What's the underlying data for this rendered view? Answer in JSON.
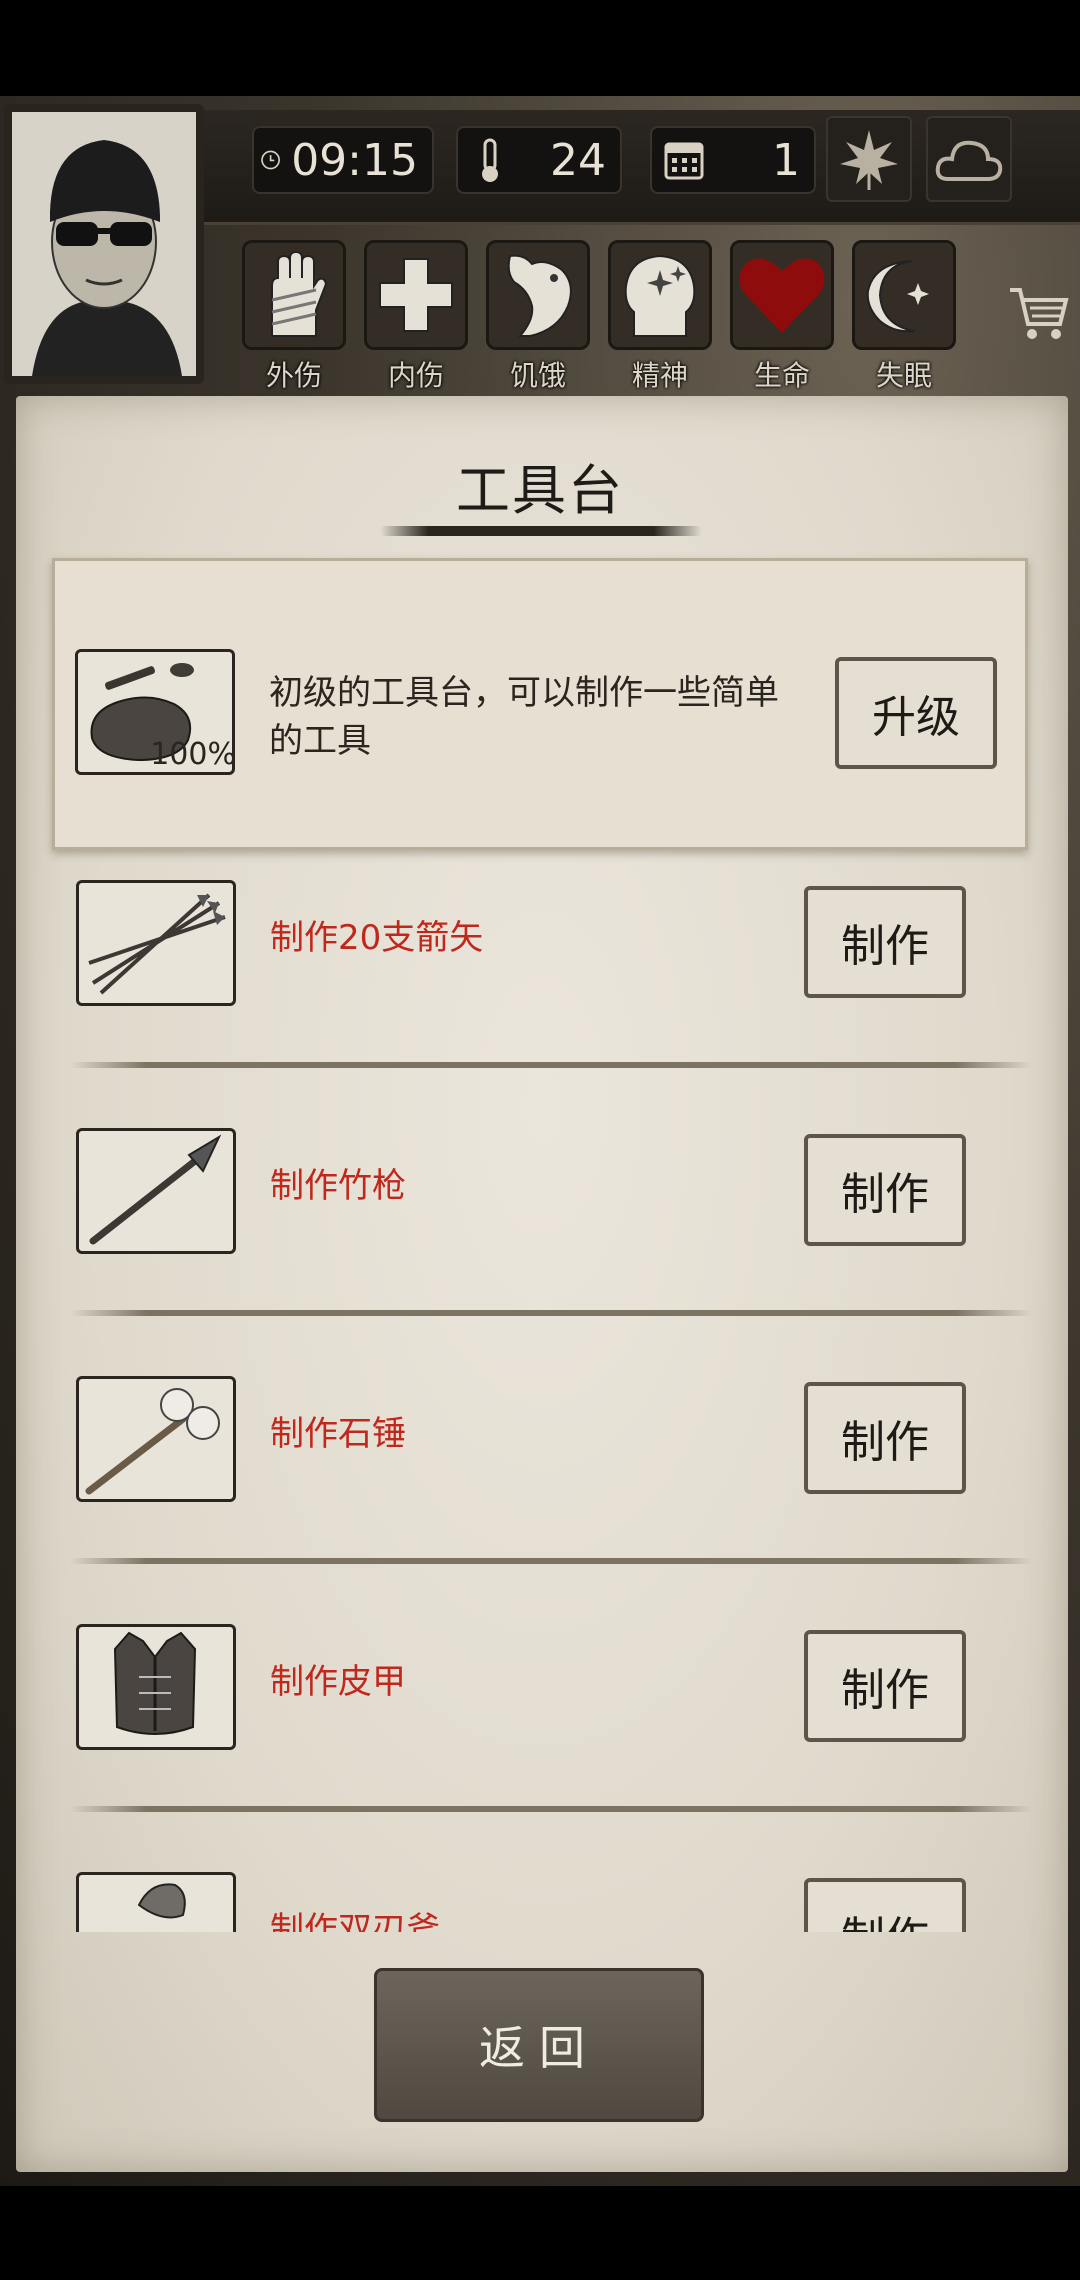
{
  "hud": {
    "time": "09:15",
    "temperature": "24",
    "day": "1",
    "icons": [
      "clock-icon",
      "thermometer-icon",
      "calendar-icon",
      "leaf-icon",
      "cloud-icon"
    ]
  },
  "statuses": [
    {
      "label": "外伤",
      "icon": "bandaged-hand-icon"
    },
    {
      "label": "内伤",
      "icon": "cross-icon"
    },
    {
      "label": "饥饿",
      "icon": "stomach-icon"
    },
    {
      "label": "精神",
      "icon": "head-sparkle-icon"
    },
    {
      "label": "生命",
      "icon": "heart-icon",
      "color": "#8e0c0c"
    },
    {
      "label": "失眠",
      "icon": "moon-star-icon"
    }
  ],
  "panel": {
    "title": "工具台",
    "featured": {
      "thumb_icon": "workbench-stones-icon",
      "percent": "100%",
      "description": "初级的工具台，可以制作一些简单的工具",
      "button": "升级"
    },
    "recipes": [
      {
        "label": "制作20支箭矢",
        "thumb_icon": "arrows-icon",
        "button": "制作"
      },
      {
        "label": "制作竹枪",
        "thumb_icon": "bamboo-spear-icon",
        "button": "制作"
      },
      {
        "label": "制作石锤",
        "thumb_icon": "stone-hammer-icon",
        "button": "制作"
      },
      {
        "label": "制作皮甲",
        "thumb_icon": "leather-armor-icon",
        "button": "制作"
      },
      {
        "label": "制作双刃斧",
        "thumb_icon": "double-axe-icon",
        "button": "制作"
      }
    ],
    "return_button": "返回"
  },
  "colors": {
    "recipe_text": "#c0281d",
    "life_heart": "#8e0c0c"
  }
}
